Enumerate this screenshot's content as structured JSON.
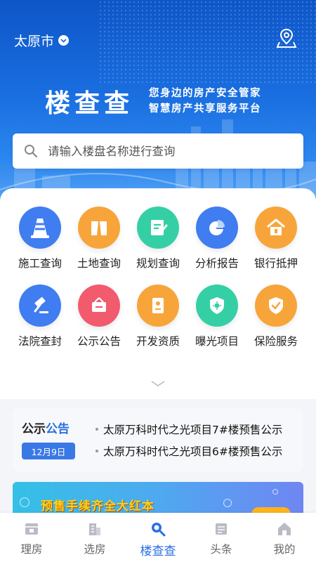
{
  "header": {
    "city": "太原市",
    "logo_title": "楼查查",
    "slogan_line1": "您身边的房产安全管家",
    "slogan_line2": "智慧房产共享服务平台"
  },
  "search": {
    "placeholder": "请输入楼盘名称进行查询"
  },
  "services": [
    {
      "label": "施工查询",
      "icon": "traffic-cone-icon",
      "color": "#3f7df0"
    },
    {
      "label": "土地查询",
      "icon": "land-icon",
      "color": "#f7a53a"
    },
    {
      "label": "规划查询",
      "icon": "planning-icon",
      "color": "#35cfa6"
    },
    {
      "label": "分析报告",
      "icon": "pie-chart-icon",
      "color": "#3f7df0"
    },
    {
      "label": "银行抵押",
      "icon": "bank-house-icon",
      "color": "#f7a53a"
    },
    {
      "label": "法院查封",
      "icon": "gavel-icon",
      "color": "#3f7df0"
    },
    {
      "label": "公示公告",
      "icon": "notice-board-icon",
      "color": "#f25a6e"
    },
    {
      "label": "开发资质",
      "icon": "certificate-icon",
      "color": "#f7a53a"
    },
    {
      "label": "曝光项目",
      "icon": "exposure-shield-icon",
      "color": "#35cfa6"
    },
    {
      "label": "保险服务",
      "icon": "insurance-shield-icon",
      "color": "#f7a53a"
    }
  ],
  "notice": {
    "title_a": "公示",
    "title_b": "公告",
    "date": "12月9日",
    "items": [
      "太原万科时代之光项目7#楼预售公示",
      "太原万科时代之光项目6#楼预售公示"
    ]
  },
  "banner": {
    "text": "预售手续齐全大红本"
  },
  "tabs": [
    {
      "label": "理房",
      "icon": "house-manage-icon"
    },
    {
      "label": "选房",
      "icon": "building-icon"
    },
    {
      "label": "楼查查",
      "icon": "search-icon"
    },
    {
      "label": "头条",
      "icon": "news-icon"
    },
    {
      "label": "我的",
      "icon": "profile-home-icon"
    }
  ],
  "colors": {
    "primary": "#2a6fe0",
    "accent_orange": "#f7a53a",
    "accent_green": "#35cfa6",
    "accent_red": "#f25a6e"
  }
}
